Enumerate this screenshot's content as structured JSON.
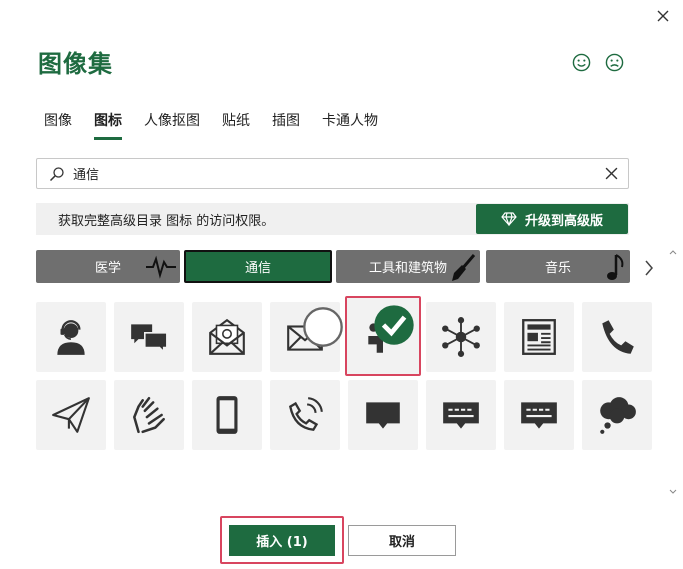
{
  "dialog": {
    "title": "图像集",
    "close_icon": "close-icon",
    "feedback_positive_icon": "smiley-icon",
    "feedback_negative_icon": "frown-icon"
  },
  "tabs": [
    {
      "label": "图像",
      "active": false
    },
    {
      "label": "图标",
      "active": true
    },
    {
      "label": "人像抠图",
      "active": false
    },
    {
      "label": "贴纸",
      "active": false
    },
    {
      "label": "插图",
      "active": false
    },
    {
      "label": "卡通人物",
      "active": false
    }
  ],
  "search": {
    "value": "通信",
    "search_icon": "search-icon",
    "clear_icon": "clear-icon"
  },
  "promo": {
    "text": "获取完整高级目录 图标 的访问权限。",
    "upgrade_label": "升级到高级版",
    "upgrade_icon": "diamond-icon"
  },
  "categories": [
    {
      "label": "医学",
      "icon": "heartbeat-icon",
      "active": false
    },
    {
      "label": "通信",
      "icon": "",
      "active": true
    },
    {
      "label": "工具和建筑物",
      "icon": "brush-icon",
      "active": false
    },
    {
      "label": "音乐",
      "icon": "music-note-icon",
      "active": false
    }
  ],
  "icons": [
    {
      "name": "headset-person-icon",
      "selected": false
    },
    {
      "name": "chat-bubbles-icon",
      "selected": false
    },
    {
      "name": "email-at-icon",
      "selected": false
    },
    {
      "name": "envelope-icon",
      "selected": false,
      "hover": true
    },
    {
      "name": "megaphone-person-icon",
      "selected": true
    },
    {
      "name": "network-hub-icon",
      "selected": false
    },
    {
      "name": "newspaper-icon",
      "selected": false
    },
    {
      "name": "phone-handset-icon",
      "selected": false
    },
    {
      "name": "paper-plane-icon",
      "selected": false
    },
    {
      "name": "sign-language-icon",
      "selected": false
    },
    {
      "name": "mobile-phone-icon",
      "selected": false
    },
    {
      "name": "phone-ringing-icon",
      "selected": false
    },
    {
      "name": "speech-bubble-icon",
      "selected": false
    },
    {
      "name": "typing-bubble-icon",
      "selected": false
    },
    {
      "name": "message-bubble-icon",
      "selected": false
    },
    {
      "name": "thought-cloud-icon",
      "selected": false
    }
  ],
  "footer": {
    "insert_label": "插入 (1)",
    "cancel_label": "取消"
  },
  "colors": {
    "accent": "#1e6b40",
    "category_bg": "#6f6f6f",
    "selection": "#d8455f"
  }
}
